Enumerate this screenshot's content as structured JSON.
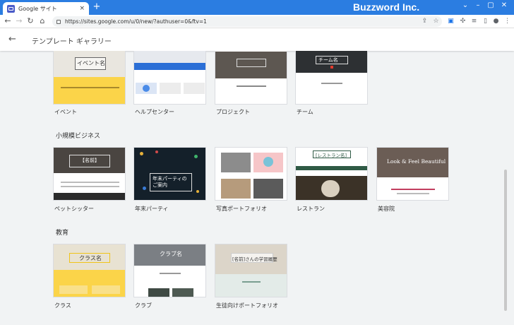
{
  "browser": {
    "tab_title": "Google サイト",
    "tab_close": "×",
    "new_tab": "+",
    "brand": "Buzzword Inc.",
    "url": "https://sites.google.com/u/0/new/?authuser=0&ftv=1"
  },
  "app": {
    "back": "←",
    "title": "テンプレート ギャラリー"
  },
  "sections": {
    "personal": {
      "cards": [
        {
          "label": "イベント",
          "thumb_text": "イベント名"
        },
        {
          "label": "ヘルプセンター",
          "thumb_text": ""
        },
        {
          "label": "プロジェクト",
          "thumb_text": ""
        },
        {
          "label": "チーム",
          "thumb_text": "チーム名"
        }
      ]
    },
    "business": {
      "title": "小規模ビジネス",
      "cards": [
        {
          "label": "ペットシッター",
          "thumb_text": "【名前】"
        },
        {
          "label": "年末パーティ",
          "thumb_text": "年末パーティのご案内"
        },
        {
          "label": "写真ポートフォリオ",
          "thumb_text": ""
        },
        {
          "label": "レストラン",
          "thumb_text": "[レストラン名]"
        },
        {
          "label": "美容院",
          "thumb_text": "Look & Feel Beautiful"
        }
      ]
    },
    "education": {
      "title": "教育",
      "cards": [
        {
          "label": "クラス",
          "thumb_text": "クラス名"
        },
        {
          "label": "クラブ",
          "thumb_text": "クラブ名"
        },
        {
          "label": "生徒向けポートフォリオ",
          "thumb_text": "[名前]さんの学習履歴"
        }
      ]
    }
  },
  "colors": {
    "chrome_blue": "#2b7de1",
    "event_yellow": "#fbd449",
    "team_dark": "#2d3033",
    "restaurant_green": "#2f5a45",
    "salon_pink": "#c23e5f"
  }
}
